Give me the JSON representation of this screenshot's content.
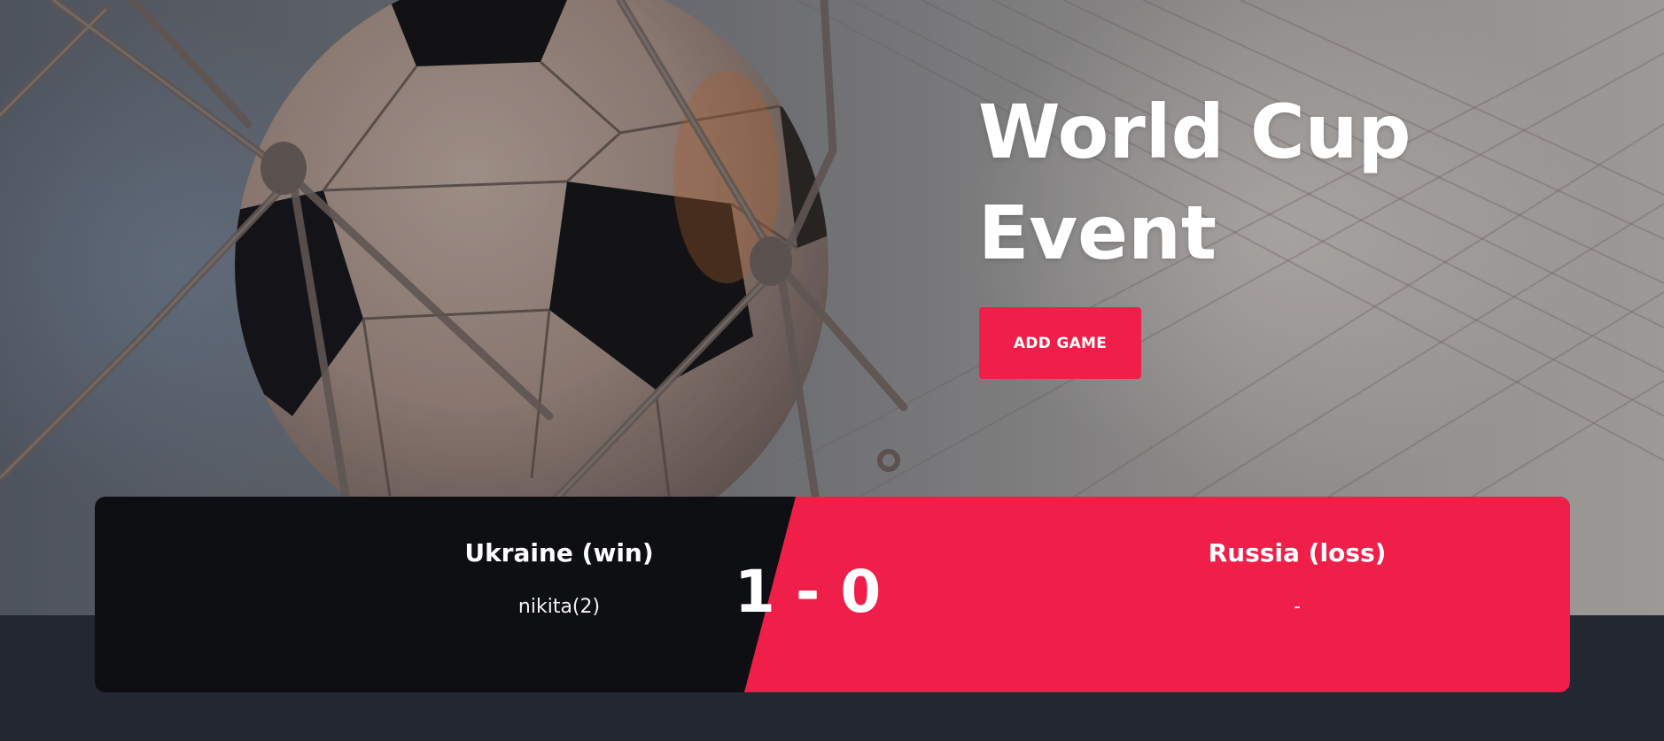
{
  "hero": {
    "title": "World Cup Event",
    "add_game_label": "ADD GAME"
  },
  "match": {
    "home": {
      "name": "Ukraine (win)",
      "scorers": "nikita(2)",
      "score": "1"
    },
    "away": {
      "name": "Russia (loss)",
      "scorers": "-",
      "score": "0"
    },
    "separator": "-"
  },
  "colors": {
    "accent": "#ef1f49",
    "dark_panel": "#0e0f13",
    "page_background": "#232732",
    "text": "#ffffff"
  },
  "icons": {
    "hero_image": "soccer-ball-in-net-image"
  }
}
